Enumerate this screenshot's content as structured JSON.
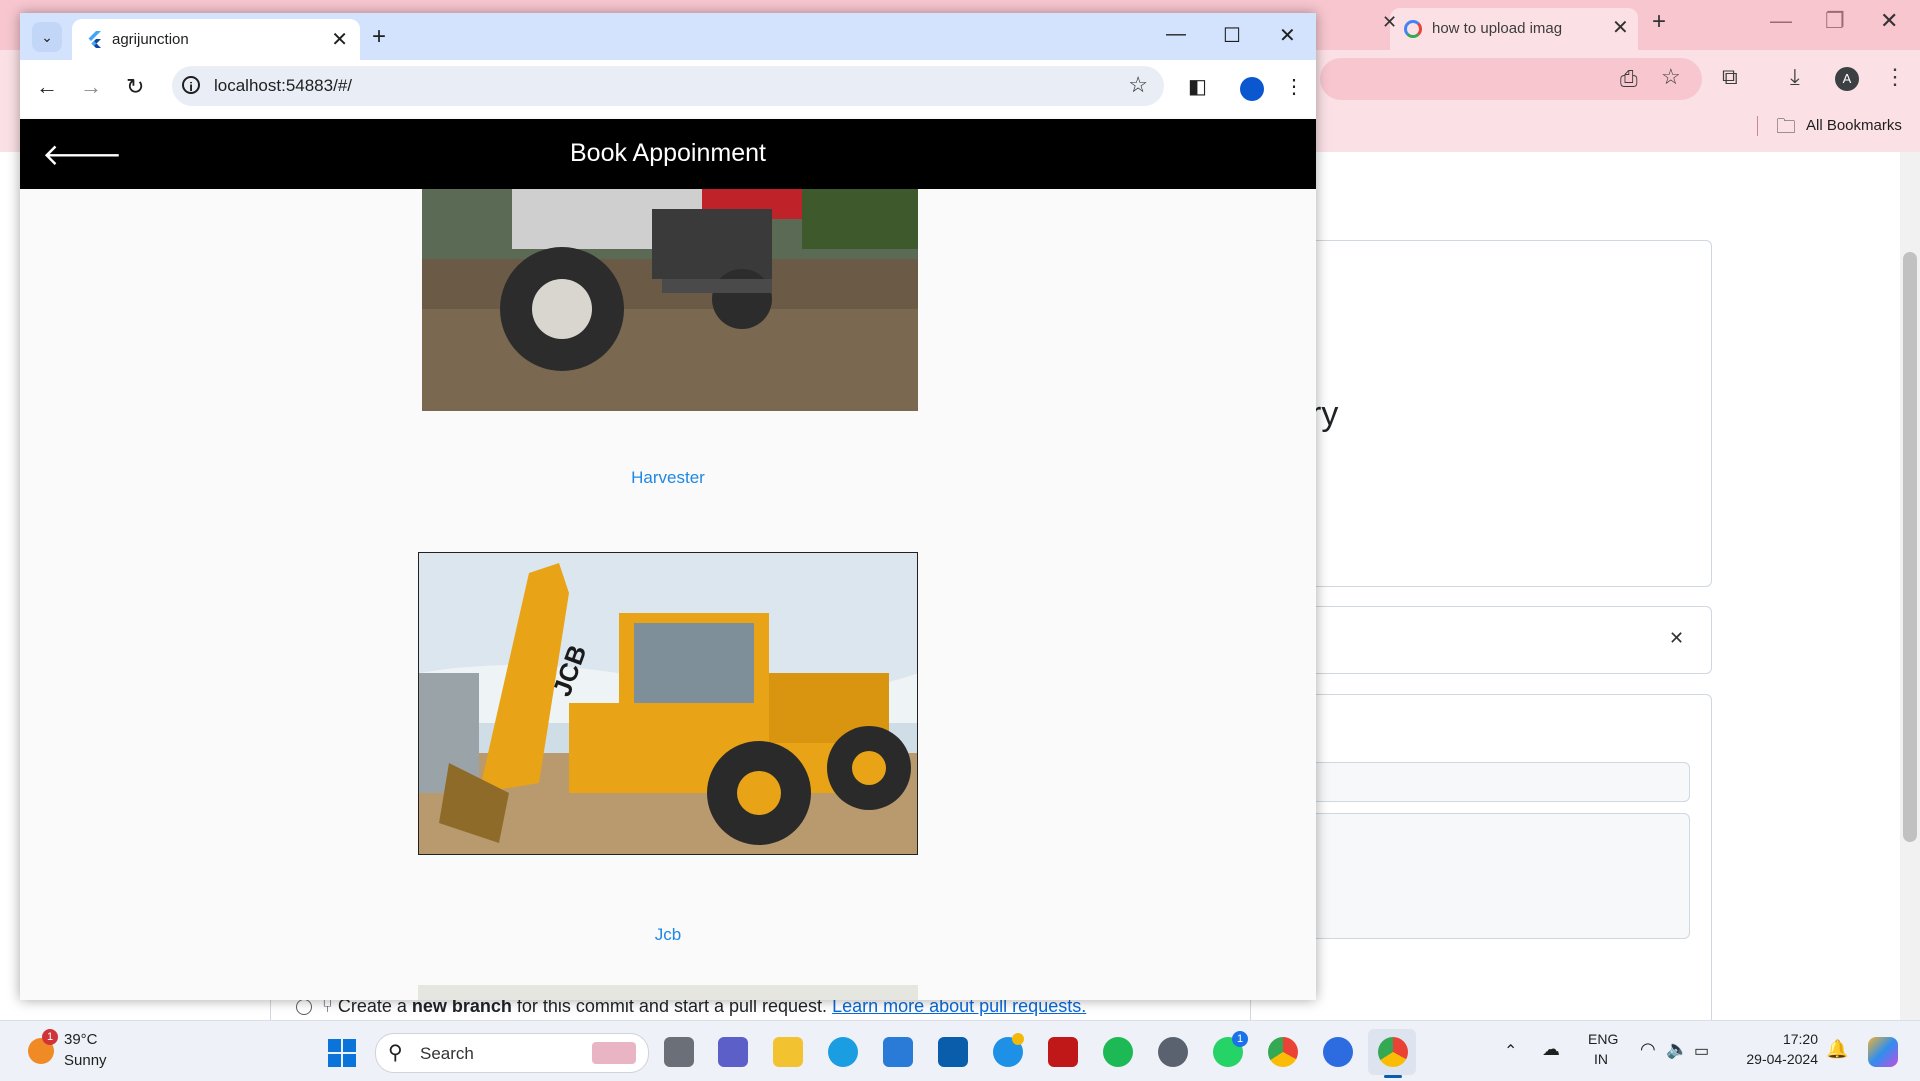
{
  "background_browser": {
    "tab_title": "how to upload imag",
    "bookmarks_label": "All Bookmarks",
    "heading_fragment": "ry",
    "commit_text_pre": "Create a ",
    "commit_text_bold": "new branch",
    "commit_text_post": " for this commit and start a pull request.",
    "commit_link": "Learn more about pull requests."
  },
  "browser": {
    "tab_title": "agrijunction",
    "url": "localhost:54883/#/",
    "colors": {
      "tabbar": "#d3e3fd",
      "omnibox": "#e9eef6"
    }
  },
  "app": {
    "title": "Book Appoinment",
    "items": [
      {
        "label": "Harvester",
        "image": "tractor-photo"
      },
      {
        "label": "Jcb",
        "image": "jcb-backhoe-photo"
      }
    ],
    "colors": {
      "appbar": "#000000",
      "label": "#1e88e5"
    }
  },
  "taskbar": {
    "weather_temp": "39°C",
    "weather_desc": "Sunny",
    "weather_badge": "1",
    "search_placeholder": "Search",
    "whatsapp_badge": "1",
    "lang_line1": "ENG",
    "lang_line2": "IN",
    "time": "17:20",
    "date": "29-04-2024"
  }
}
